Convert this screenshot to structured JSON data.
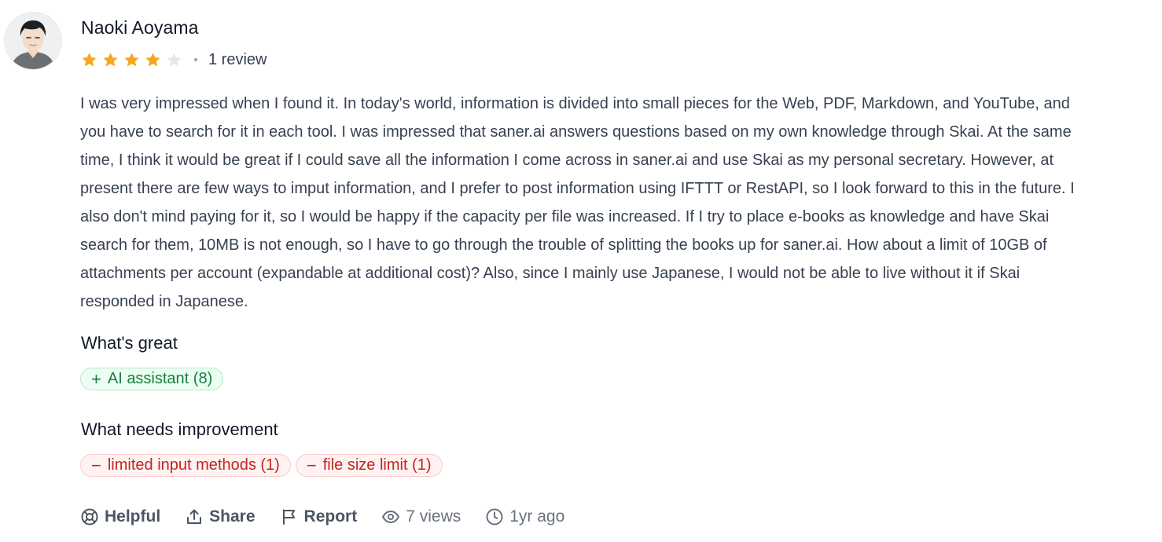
{
  "review": {
    "author": "Naoki Aoyama",
    "rating": 4,
    "rating_max": 5,
    "review_count": "1 review",
    "body": "I was very impressed when I found it. In today's world, information is divided into small pieces for the Web, PDF, Markdown, and YouTube, and you have to search for it in each tool. I was impressed that saner.ai answers questions based on my own knowledge through Skai. At the same time, I think it would be great if I could save all the information I come across in saner.ai and use Skai as my personal secretary. However, at present there are few ways to imput information, and I prefer to post information using IFTTT or RestAPI, so I look forward to this in the future. I also don't mind paying for it, so I would be happy if the capacity per file was increased. If I try to place e-books as knowledge and have Skai search for them, 10MB is not enough, so I have to go through the trouble of splitting the books up for saner.ai. How about a limit of 10GB of attachments per account (expandable at additional cost)? Also, since I mainly use Japanese, I would not be able to live without it if Skai responded in Japanese."
  },
  "great": {
    "title": "What's great",
    "tags": [
      {
        "symbol": "+",
        "label": "AI assistant (8)"
      }
    ]
  },
  "improve": {
    "title": "What needs improvement",
    "tags": [
      {
        "symbol": "−",
        "label": "limited input methods (1)"
      },
      {
        "symbol": "−",
        "label": "file size limit (1)"
      }
    ]
  },
  "actions": {
    "helpful": "Helpful",
    "share": "Share",
    "report": "Report",
    "views": "7 views",
    "time": "1yr ago"
  },
  "colors": {
    "star_filled": "#f5a623",
    "star_empty": "#e5e7eb",
    "positive": "#16803d",
    "negative": "#c2261d"
  },
  "icons": [
    "lifebuoy-icon",
    "share-icon",
    "flag-icon",
    "eye-icon",
    "clock-icon"
  ]
}
